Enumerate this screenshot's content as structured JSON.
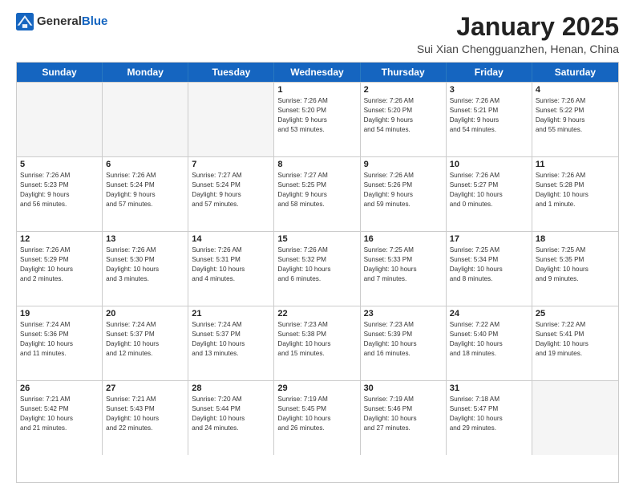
{
  "logo": {
    "general": "General",
    "blue": "Blue"
  },
  "title": "January 2025",
  "subtitle": "Sui Xian Chengguanzhen, Henan, China",
  "headers": [
    "Sunday",
    "Monday",
    "Tuesday",
    "Wednesday",
    "Thursday",
    "Friday",
    "Saturday"
  ],
  "rows": [
    [
      {
        "day": "",
        "lines": [],
        "empty": true
      },
      {
        "day": "",
        "lines": [],
        "empty": true
      },
      {
        "day": "",
        "lines": [],
        "empty": true
      },
      {
        "day": "1",
        "lines": [
          "Sunrise: 7:26 AM",
          "Sunset: 5:20 PM",
          "Daylight: 9 hours",
          "and 53 minutes."
        ]
      },
      {
        "day": "2",
        "lines": [
          "Sunrise: 7:26 AM",
          "Sunset: 5:20 PM",
          "Daylight: 9 hours",
          "and 54 minutes."
        ]
      },
      {
        "day": "3",
        "lines": [
          "Sunrise: 7:26 AM",
          "Sunset: 5:21 PM",
          "Daylight: 9 hours",
          "and 54 minutes."
        ]
      },
      {
        "day": "4",
        "lines": [
          "Sunrise: 7:26 AM",
          "Sunset: 5:22 PM",
          "Daylight: 9 hours",
          "and 55 minutes."
        ]
      }
    ],
    [
      {
        "day": "5",
        "lines": [
          "Sunrise: 7:26 AM",
          "Sunset: 5:23 PM",
          "Daylight: 9 hours",
          "and 56 minutes."
        ]
      },
      {
        "day": "6",
        "lines": [
          "Sunrise: 7:26 AM",
          "Sunset: 5:24 PM",
          "Daylight: 9 hours",
          "and 57 minutes."
        ]
      },
      {
        "day": "7",
        "lines": [
          "Sunrise: 7:27 AM",
          "Sunset: 5:24 PM",
          "Daylight: 9 hours",
          "and 57 minutes."
        ]
      },
      {
        "day": "8",
        "lines": [
          "Sunrise: 7:27 AM",
          "Sunset: 5:25 PM",
          "Daylight: 9 hours",
          "and 58 minutes."
        ]
      },
      {
        "day": "9",
        "lines": [
          "Sunrise: 7:26 AM",
          "Sunset: 5:26 PM",
          "Daylight: 9 hours",
          "and 59 minutes."
        ]
      },
      {
        "day": "10",
        "lines": [
          "Sunrise: 7:26 AM",
          "Sunset: 5:27 PM",
          "Daylight: 10 hours",
          "and 0 minutes."
        ]
      },
      {
        "day": "11",
        "lines": [
          "Sunrise: 7:26 AM",
          "Sunset: 5:28 PM",
          "Daylight: 10 hours",
          "and 1 minute."
        ]
      }
    ],
    [
      {
        "day": "12",
        "lines": [
          "Sunrise: 7:26 AM",
          "Sunset: 5:29 PM",
          "Daylight: 10 hours",
          "and 2 minutes."
        ]
      },
      {
        "day": "13",
        "lines": [
          "Sunrise: 7:26 AM",
          "Sunset: 5:30 PM",
          "Daylight: 10 hours",
          "and 3 minutes."
        ]
      },
      {
        "day": "14",
        "lines": [
          "Sunrise: 7:26 AM",
          "Sunset: 5:31 PM",
          "Daylight: 10 hours",
          "and 4 minutes."
        ]
      },
      {
        "day": "15",
        "lines": [
          "Sunrise: 7:26 AM",
          "Sunset: 5:32 PM",
          "Daylight: 10 hours",
          "and 6 minutes."
        ]
      },
      {
        "day": "16",
        "lines": [
          "Sunrise: 7:25 AM",
          "Sunset: 5:33 PM",
          "Daylight: 10 hours",
          "and 7 minutes."
        ]
      },
      {
        "day": "17",
        "lines": [
          "Sunrise: 7:25 AM",
          "Sunset: 5:34 PM",
          "Daylight: 10 hours",
          "and 8 minutes."
        ]
      },
      {
        "day": "18",
        "lines": [
          "Sunrise: 7:25 AM",
          "Sunset: 5:35 PM",
          "Daylight: 10 hours",
          "and 9 minutes."
        ]
      }
    ],
    [
      {
        "day": "19",
        "lines": [
          "Sunrise: 7:24 AM",
          "Sunset: 5:36 PM",
          "Daylight: 10 hours",
          "and 11 minutes."
        ]
      },
      {
        "day": "20",
        "lines": [
          "Sunrise: 7:24 AM",
          "Sunset: 5:37 PM",
          "Daylight: 10 hours",
          "and 12 minutes."
        ]
      },
      {
        "day": "21",
        "lines": [
          "Sunrise: 7:24 AM",
          "Sunset: 5:37 PM",
          "Daylight: 10 hours",
          "and 13 minutes."
        ]
      },
      {
        "day": "22",
        "lines": [
          "Sunrise: 7:23 AM",
          "Sunset: 5:38 PM",
          "Daylight: 10 hours",
          "and 15 minutes."
        ]
      },
      {
        "day": "23",
        "lines": [
          "Sunrise: 7:23 AM",
          "Sunset: 5:39 PM",
          "Daylight: 10 hours",
          "and 16 minutes."
        ]
      },
      {
        "day": "24",
        "lines": [
          "Sunrise: 7:22 AM",
          "Sunset: 5:40 PM",
          "Daylight: 10 hours",
          "and 18 minutes."
        ]
      },
      {
        "day": "25",
        "lines": [
          "Sunrise: 7:22 AM",
          "Sunset: 5:41 PM",
          "Daylight: 10 hours",
          "and 19 minutes."
        ]
      }
    ],
    [
      {
        "day": "26",
        "lines": [
          "Sunrise: 7:21 AM",
          "Sunset: 5:42 PM",
          "Daylight: 10 hours",
          "and 21 minutes."
        ]
      },
      {
        "day": "27",
        "lines": [
          "Sunrise: 7:21 AM",
          "Sunset: 5:43 PM",
          "Daylight: 10 hours",
          "and 22 minutes."
        ]
      },
      {
        "day": "28",
        "lines": [
          "Sunrise: 7:20 AM",
          "Sunset: 5:44 PM",
          "Daylight: 10 hours",
          "and 24 minutes."
        ]
      },
      {
        "day": "29",
        "lines": [
          "Sunrise: 7:19 AM",
          "Sunset: 5:45 PM",
          "Daylight: 10 hours",
          "and 26 minutes."
        ]
      },
      {
        "day": "30",
        "lines": [
          "Sunrise: 7:19 AM",
          "Sunset: 5:46 PM",
          "Daylight: 10 hours",
          "and 27 minutes."
        ]
      },
      {
        "day": "31",
        "lines": [
          "Sunrise: 7:18 AM",
          "Sunset: 5:47 PM",
          "Daylight: 10 hours",
          "and 29 minutes."
        ]
      },
      {
        "day": "",
        "lines": [],
        "empty": true
      }
    ]
  ]
}
